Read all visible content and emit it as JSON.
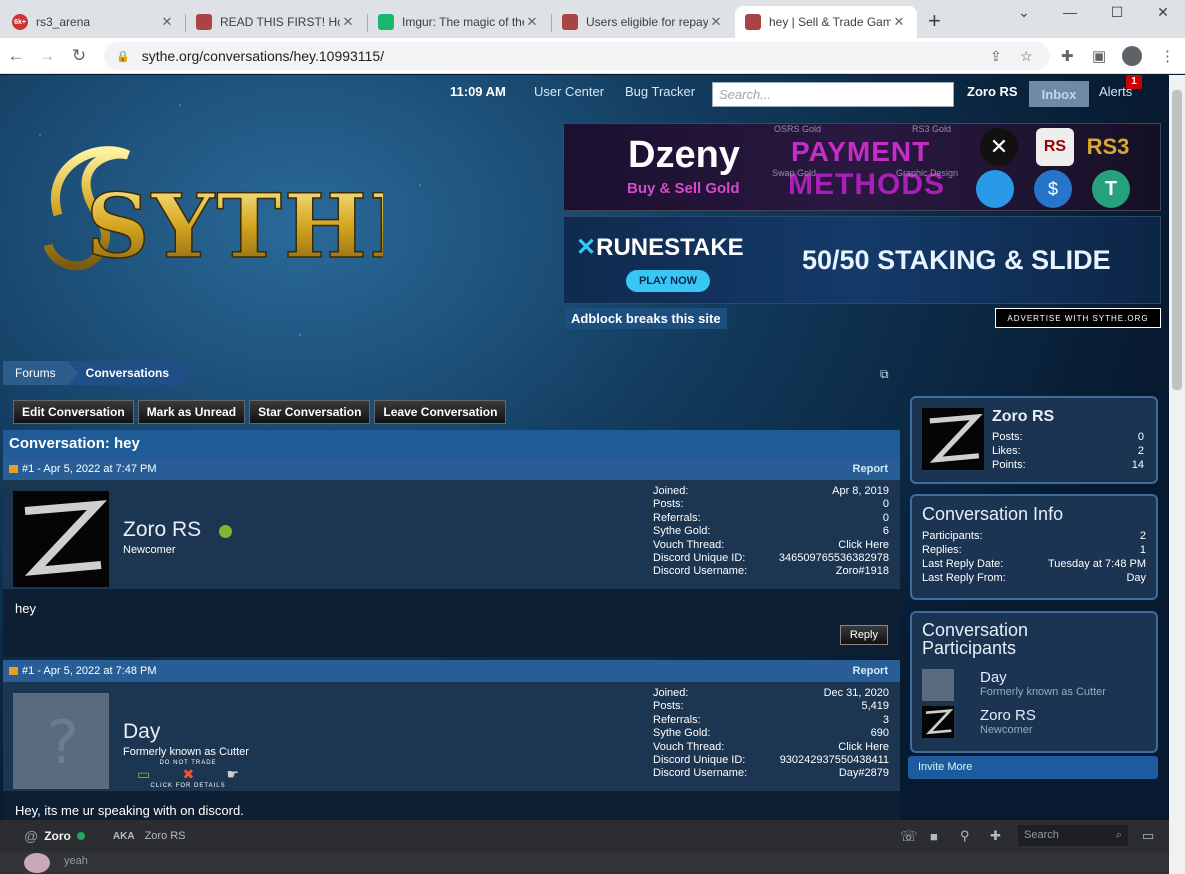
{
  "browser": {
    "tabs": [
      {
        "label": "rs3_arena",
        "favicon": "6k+",
        "color": "#cc3333"
      },
      {
        "label": "READ THIS FIRST! How",
        "color": "#aa4444"
      },
      {
        "label": "Imgur: The magic of the",
        "color": "#1bb76e"
      },
      {
        "label": "Users eligible for repay",
        "color": "#aa4444"
      },
      {
        "label": "hey | Sell & Trade Gam",
        "color": "#aa4444",
        "active": true
      }
    ],
    "url": "sythe.org/conversations/hey.10993115/"
  },
  "topnav": {
    "time": "11:09 AM",
    "user_center": "User Center",
    "bug_tracker": "Bug Tracker",
    "search_placeholder": "Search...",
    "username": "Zoro RS",
    "inbox": "Inbox",
    "alerts": "Alerts",
    "alerts_count": "1"
  },
  "ads": {
    "ad1": {
      "brand": "Dzeny",
      "tagline": "Buy & Sell Gold",
      "headline1": "PAYMENT",
      "headline2": "METHODS",
      "sub1": "OSRS Gold",
      "sub2": "RS3 Gold",
      "sub3": "Swap Gold",
      "sub4": "Graphic Design"
    },
    "ad2": {
      "brand": "RUNESTAKE",
      "cta": "PLAY NOW",
      "headline": "50/50 STAKING & SLIDE"
    },
    "adblock": "Adblock breaks this site",
    "advertise": "ADVERTISE WITH SYTHE.ORG"
  },
  "logo_text": "SYTHE",
  "breadcrumb": [
    "Forums",
    "Conversations"
  ],
  "actions": [
    "Edit Conversation",
    "Mark as Unread",
    "Star Conversation",
    "Leave Conversation"
  ],
  "conversation_title": "Conversation: hey",
  "posts": [
    {
      "header": "#1 - Apr 5, 2022 at 7:47 PM",
      "report": "Report",
      "name": "Zoro RS",
      "title": "Newcomer",
      "online": true,
      "stats": [
        [
          "Joined:",
          "Apr 8, 2019"
        ],
        [
          "Posts:",
          "0"
        ],
        [
          "Referrals:",
          "0"
        ],
        [
          "Sythe Gold:",
          "6"
        ],
        [
          "Vouch Thread:",
          "Click Here"
        ],
        [
          "Discord Unique ID:",
          "346509765536382978"
        ],
        [
          "Discord Username:",
          "Zoro#1918"
        ]
      ],
      "message": "hey",
      "reply": "Reply"
    },
    {
      "header": "#1 - Apr 5, 2022 at 7:48 PM",
      "report": "Report",
      "name": "Day",
      "title": "Formerly known as Cutter",
      "donot": "DO NOT TRADE",
      "clickdetails": "CLICK FOR DETAILS",
      "stats": [
        [
          "Joined:",
          "Dec 31, 2020"
        ],
        [
          "Posts:",
          "5,419"
        ],
        [
          "Referrals:",
          "3"
        ],
        [
          "Sythe Gold:",
          "690"
        ],
        [
          "Vouch Thread:",
          "Click Here"
        ],
        [
          "Discord Unique ID:",
          "930242937550438411"
        ],
        [
          "Discord Username:",
          "Day#2879"
        ]
      ],
      "message": "Hey, its me ur speaking with on discord."
    }
  ],
  "sidebar": {
    "profile": {
      "name": "Zoro RS",
      "stats": [
        [
          "Posts:",
          "0"
        ],
        [
          "Likes:",
          "2"
        ],
        [
          "Points:",
          "14"
        ]
      ]
    },
    "info": {
      "title": "Conversation Info",
      "stats": [
        [
          "Participants:",
          "2"
        ],
        [
          "Replies:",
          "1"
        ],
        [
          "Last Reply Date:",
          "Tuesday at 7:48 PM"
        ],
        [
          "Last Reply From:",
          "Day"
        ]
      ]
    },
    "participants": {
      "title1": "Conversation",
      "title2": "Participants",
      "list": [
        {
          "name": "Day",
          "sub": "Formerly known as Cutter"
        },
        {
          "name": "Zoro RS",
          "sub": "Newcomer"
        }
      ]
    },
    "invite": "Invite More"
  },
  "discord": {
    "user": "Zoro",
    "aka_label": "AKA",
    "aka": "Zoro RS",
    "search": "Search",
    "preview": "yeah"
  }
}
